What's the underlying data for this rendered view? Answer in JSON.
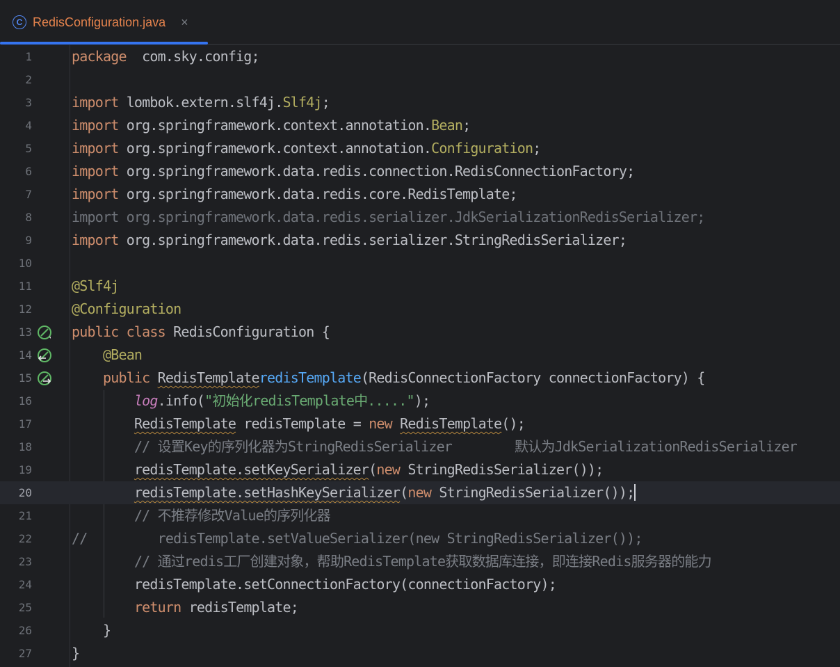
{
  "tab": {
    "icon": "class-icon",
    "icon_letter": "C",
    "title": "RedisConfiguration.java",
    "close": "×"
  },
  "editor": {
    "current_line": 20,
    "lines": [
      {
        "n": "1",
        "gutter_icon": null,
        "tokens": [
          [
            "kw",
            "package"
          ],
          [
            "",
            "  com.sky.config;"
          ]
        ]
      },
      {
        "n": "2",
        "gutter_icon": null,
        "tokens": []
      },
      {
        "n": "3",
        "gutter_icon": null,
        "tokens": [
          [
            "kw",
            "import"
          ],
          [
            "",
            " lombok.extern.slf4j."
          ],
          [
            "ann",
            "Slf4j"
          ],
          [
            "",
            ";"
          ]
        ]
      },
      {
        "n": "4",
        "gutter_icon": null,
        "tokens": [
          [
            "kw",
            "import"
          ],
          [
            "",
            " org.springframework.context.annotation."
          ],
          [
            "ann",
            "Bean"
          ],
          [
            "",
            ";"
          ]
        ]
      },
      {
        "n": "5",
        "gutter_icon": null,
        "tokens": [
          [
            "kw",
            "import"
          ],
          [
            "",
            " org.springframework.context.annotation."
          ],
          [
            "ann",
            "Configuration"
          ],
          [
            "",
            ";"
          ]
        ]
      },
      {
        "n": "6",
        "gutter_icon": null,
        "tokens": [
          [
            "kw",
            "import"
          ],
          [
            "",
            " org.springframework.data.redis.connection.RedisConnectionFactory;"
          ]
        ]
      },
      {
        "n": "7",
        "gutter_icon": null,
        "tokens": [
          [
            "kw",
            "import"
          ],
          [
            "",
            " org.springframework.data.redis.core.RedisTemplate;"
          ]
        ]
      },
      {
        "n": "8",
        "gutter_icon": null,
        "tokens": [
          [
            "dim",
            "import org.springframework.data.redis.serializer.JdkSerializationRedisSerializer;"
          ]
        ]
      },
      {
        "n": "9",
        "gutter_icon": null,
        "tokens": [
          [
            "kw",
            "import"
          ],
          [
            "",
            " org.springframework.data.redis.serializer.StringRedisSerializer;"
          ]
        ]
      },
      {
        "n": "10",
        "gutter_icon": null,
        "tokens": []
      },
      {
        "n": "11",
        "gutter_icon": null,
        "tokens": [
          [
            "ann",
            "@Slf4j"
          ]
        ]
      },
      {
        "n": "12",
        "gutter_icon": null,
        "tokens": [
          [
            "ann",
            "@Configuration"
          ]
        ]
      },
      {
        "n": "13",
        "gutter_icon": "spring-bean-icon",
        "tokens": [
          [
            "kw",
            "public class"
          ],
          [
            "",
            " RedisConfiguration {"
          ]
        ]
      },
      {
        "n": "14",
        "gutter_icon": "spring-bean-back-icon",
        "tokens": [
          [
            "",
            "    "
          ],
          [
            "ann",
            "@Bean"
          ]
        ]
      },
      {
        "n": "15",
        "gutter_icon": "spring-bean-forward-icon",
        "tokens": [
          [
            "",
            "    "
          ],
          [
            "kw",
            "public "
          ],
          [
            "squig",
            "RedisTemplate"
          ],
          [
            "",
            "",
            " "
          ],
          [
            "fn",
            "redisTemplate"
          ],
          [
            "",
            "(RedisConnectionFactory connectionFactory) {"
          ]
        ]
      },
      {
        "n": "16",
        "gutter_icon": null,
        "tokens": [
          [
            "",
            "        "
          ],
          [
            "field",
            "log"
          ],
          [
            "",
            ".info("
          ],
          [
            "str",
            "\"初始化redisTemplate中.....\""
          ],
          [
            "",
            ");"
          ]
        ]
      },
      {
        "n": "17",
        "gutter_icon": null,
        "tokens": [
          [
            "",
            "        "
          ],
          [
            "squig",
            "RedisTemplate"
          ],
          [
            "",
            " redisTemplate = "
          ],
          [
            "kw",
            "new "
          ],
          [
            "squig",
            "RedisTemplate"
          ],
          [
            "",
            "();"
          ]
        ]
      },
      {
        "n": "18",
        "gutter_icon": null,
        "tokens": [
          [
            "",
            "        "
          ],
          [
            "cmt",
            "// 设置Key的序列化器为StringRedisSerializer        默认为JdkSerializationRedisSerializer"
          ]
        ]
      },
      {
        "n": "19",
        "gutter_icon": null,
        "tokens": [
          [
            "",
            "        "
          ],
          [
            "squig",
            "redisTemplate.setKeySerializer"
          ],
          [
            "",
            "("
          ],
          [
            "kw",
            "new "
          ],
          [
            "",
            "StringRedisSerializer());"
          ]
        ]
      },
      {
        "n": "20",
        "gutter_icon": null,
        "tokens": [
          [
            "",
            "        "
          ],
          [
            "squig",
            "redisTemplate.setHashKeySerializer"
          ],
          [
            "",
            "("
          ],
          [
            "kw",
            "new "
          ],
          [
            "",
            "StringRedisSerializer());"
          ],
          [
            "caret",
            ""
          ]
        ]
      },
      {
        "n": "21",
        "gutter_icon": null,
        "tokens": [
          [
            "",
            "        "
          ],
          [
            "cmt",
            "// 不推荐修改Value的序列化器"
          ]
        ]
      },
      {
        "n": "22",
        "gutter_icon": null,
        "tokens": [
          [
            "cmt",
            "//         redisTemplate.setValueSerializer(new StringRedisSerializer());"
          ]
        ]
      },
      {
        "n": "23",
        "gutter_icon": null,
        "tokens": [
          [
            "",
            "        "
          ],
          [
            "cmt",
            "// 通过redis工厂创建对象，帮助RedisTemplate获取数据库连接，即连接Redis服务器的能力"
          ]
        ]
      },
      {
        "n": "24",
        "gutter_icon": null,
        "tokens": [
          [
            "",
            "        redisTemplate.setConnectionFactory(connectionFactory);"
          ]
        ]
      },
      {
        "n": "25",
        "gutter_icon": null,
        "tokens": [
          [
            "",
            "        "
          ],
          [
            "kw",
            "return"
          ],
          [
            "",
            " redisTemplate;"
          ]
        ]
      },
      {
        "n": "26",
        "gutter_icon": null,
        "tokens": [
          [
            "",
            "    }"
          ]
        ]
      },
      {
        "n": "27",
        "gutter_icon": null,
        "tokens": [
          [
            "",
            "}"
          ]
        ]
      }
    ]
  },
  "colors": {
    "background": "#1e1f22",
    "keyword": "#cf8e6d",
    "annotation": "#b3ae60",
    "string": "#6aab73",
    "comment": "#7a7e85",
    "method": "#56a8f5",
    "tab_accent": "#3574f0",
    "tab_title": "#e5834d"
  }
}
